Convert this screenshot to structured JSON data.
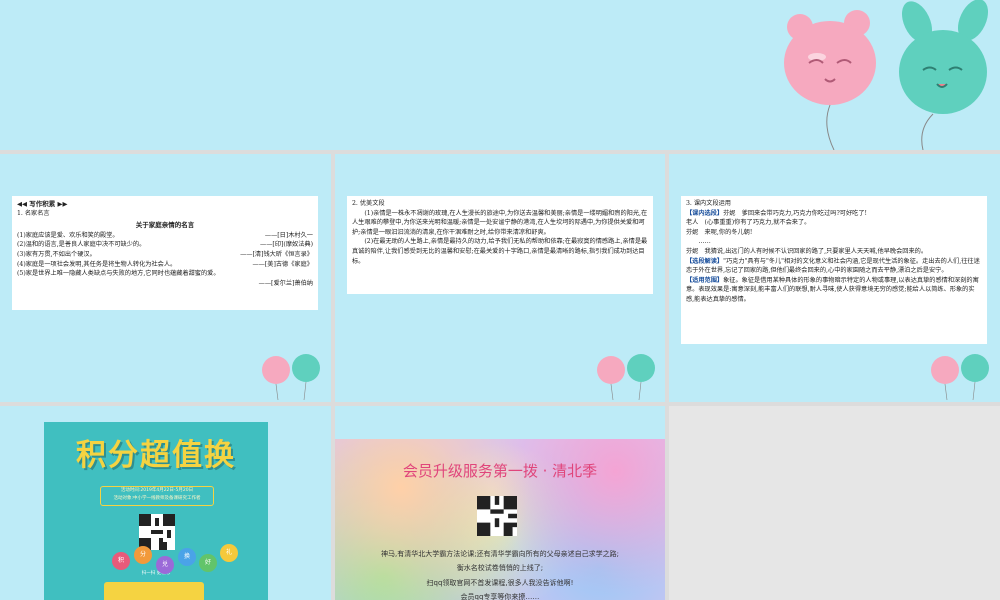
{
  "slide1": {
    "header": "写作积累",
    "section": "1. 名家名言",
    "title": "关于家庭亲情的名言",
    "quotes": [
      {
        "text": "(1)家庭应该是爱、欢乐和笑的殿堂。",
        "source": "——[日]木村久一"
      },
      {
        "text": "(2)温和的语言,是善良人家庭中决不可缺少的。",
        "source": "——[印](摩奴法典)"
      },
      {
        "text": "(3)家有万贯,不如出个硬汉。",
        "source": "——[清]钱大昕《恒言录》"
      },
      {
        "text": "(4)家庭是一项社会发明,其任务是将生物人转化为社会人。",
        "source": "——[美]古德《家庭》"
      },
      {
        "text": "(5)家是世界上唯一隐藏人类缺点与失败的地方,它同时也蕴藏着甜蜜的爱。",
        "source": "——[爱尔兰]萧伯纳"
      }
    ]
  },
  "slide2": {
    "section": "2. 优美文段",
    "paragraphs": [
      "(1)亲情是一株永不凋谢的玫瑰,在人生漫长的旅途中,为你送去温馨和美丽;亲情是一缕明媚和煦的阳光,在人生艰难的攀登中,为你送来光明和温暖;亲情是一处安谧宁静的港湾,在人生坎坷的际遇中,为你提供关爱和呵护;亲情是一眼汩汩流淌的清泉,在你干涸难耐之时,给你带来清凉和舒爽。",
      "(2)在最无助的人生路上,亲情是最持久的动力,给予我们无私的帮助和依靠;在最寂寞的情感路上,亲情是最真诚的陪伴,让我们感受到无比的温馨和安慰;在最关爱的十字路口,亲情是最清晰的路标,指引我们成功到达目标。"
    ]
  },
  "slide3": {
    "section": "3. 课内文段运用",
    "select_label": "【课内选段】",
    "select_lines": [
      "芬妮　爹回来会带巧克力,巧克力你吃过吗?可好吃了!",
      "老人　(心事重重)你有了巧克力,就不会来了。",
      "芬妮　来呢,你的冬儿朝!",
      "……",
      "芬妮　我猜说,出远门的人有时候不认识回家的路了,只要家里人天天喊,他早晚会回来的。"
    ],
    "read_label": "【选段解读】",
    "read_text": "\"巧克力\"具有与\"冬儿\"相对的文化意义和社会内涵,它是现代生活的象征。走出去的人们,往往迷恋于外在世界,忘记了回家的路,但他们最终会回来的,心中的家園随之而去平静,漂泊之后是安宁。",
    "use_label": "【适用范围】",
    "use_text": "象征。象征是借用某种具体的形象的事物暗示特定的人物或事理,以表达真挚的感情和深刻的寓意。表现效果是:寓意深刻,能丰富人们的联想,耐人寻味,使人获得意境无穷的感觉;能给人以简练、形象的实感,能表达真挚的感情。"
  },
  "promo": {
    "title": "积分超值换",
    "info_line1": "活动时间:2019年4月22日-5月20日",
    "info_line2": "活动对象:中小学一线教师及备课研究工作者",
    "caption": "扫一扫 更精彩",
    "bubbles": [
      "积",
      "分",
      "兑",
      "换",
      "好",
      "礼"
    ]
  },
  "banner": {
    "title": "会员升级服务第一拨 · 清北季",
    "line1": "神马,有清华北大学霸方法论课;还有清华学霸向所有的父母亲述自己求学之路;",
    "line2": "衡水名校试卷悄悄的上线了;",
    "line3": "扫qq领取官网不首发课程,很多人我没告诉他啊!",
    "line4": "会员qq专享等你来撩……"
  },
  "colors": {
    "slide_bg": "#bdebf7",
    "balloon_pink": "#f6a9bf",
    "balloon_teal": "#5fd0be",
    "promo_bg": "#40bfc0",
    "promo_title": "#f5d341"
  }
}
